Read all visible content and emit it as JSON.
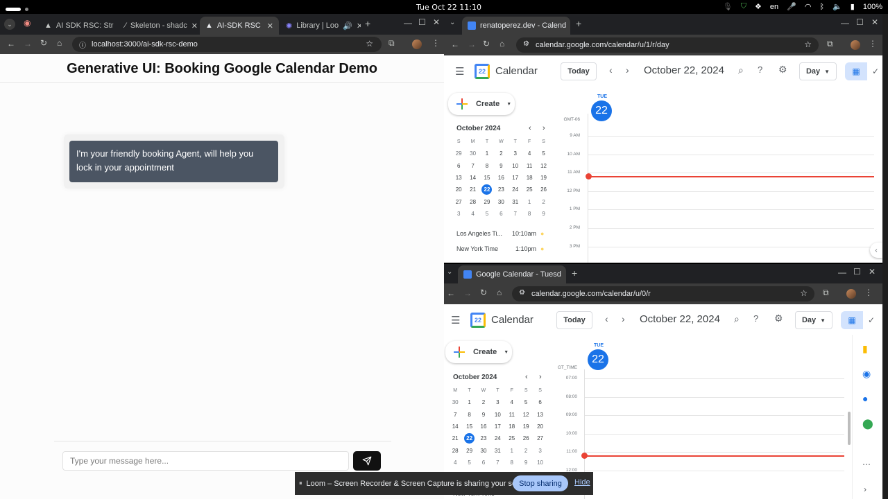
{
  "system": {
    "clock": "Tue Oct 22  11:10",
    "lang": "en",
    "battery": "100%"
  },
  "left_browser": {
    "tabs": [
      {
        "label": "AI SDK RSC: Str",
        "color": "#1a1a1a"
      },
      {
        "label": "Skeleton - shadc",
        "color": "#1a1a1a"
      },
      {
        "label": "AI-SDK RSC",
        "color": "#1a1a1a",
        "active": true
      },
      {
        "label": "Library | Loo",
        "color": "#625df5"
      }
    ],
    "url": "localhost:3000/ai-sdk-rsc-demo"
  },
  "app": {
    "title": "Generative UI: Booking Google Calendar Demo",
    "agent_message": "I'm your friendly booking Agent, will help you lock in your appointment",
    "input_placeholder": "Type your message here..."
  },
  "cal_top": {
    "tab_label": "renatoperez.dev - Calend",
    "url": "calendar.google.com/calendar/u/1/r/day",
    "app_name": "Calendar",
    "today_btn": "Today",
    "date_title": "October 22, 2024",
    "view": "Day",
    "create": "Create",
    "mini_month": "October 2024",
    "dow": [
      "S",
      "M",
      "T",
      "W",
      "T",
      "F",
      "S"
    ],
    "weeks": [
      [
        "29",
        "30",
        "1",
        "2",
        "3",
        "4",
        "5"
      ],
      [
        "6",
        "7",
        "8",
        "9",
        "10",
        "11",
        "12"
      ],
      [
        "13",
        "14",
        "15",
        "16",
        "17",
        "18",
        "19"
      ],
      [
        "20",
        "21",
        "22",
        "23",
        "24",
        "25",
        "26"
      ],
      [
        "27",
        "28",
        "29",
        "30",
        "31",
        "1",
        "2"
      ],
      [
        "3",
        "4",
        "5",
        "6",
        "7",
        "8",
        "9"
      ]
    ],
    "day_dow": "TUE",
    "day_num": "22",
    "tz": "GMT-06",
    "hours": [
      "9 AM",
      "10 AM",
      "11 AM",
      "12 PM",
      "1 PM",
      "2 PM",
      "3 PM"
    ],
    "clocks": [
      {
        "label": "Los Angeles Ti...",
        "time": "10:10am"
      },
      {
        "label": "New York Time",
        "time": "1:10pm"
      }
    ]
  },
  "cal_bottom": {
    "tab_label": "Google Calendar - Tuesd",
    "url": "calendar.google.com/calendar/u/0/r",
    "app_name": "Calendar",
    "today_btn": "Today",
    "date_title": "October 22, 2024",
    "view": "Day",
    "create": "Create",
    "mini_month": "October 2024",
    "dow": [
      "M",
      "T",
      "W",
      "T",
      "F",
      "S",
      "S"
    ],
    "weeks": [
      [
        "30",
        "1",
        "2",
        "3",
        "4",
        "5",
        "6"
      ],
      [
        "7",
        "8",
        "9",
        "10",
        "11",
        "12",
        "13"
      ],
      [
        "14",
        "15",
        "16",
        "17",
        "18",
        "19",
        "20"
      ],
      [
        "21",
        "22",
        "23",
        "24",
        "25",
        "26",
        "27"
      ],
      [
        "28",
        "29",
        "30",
        "31",
        "1",
        "2",
        "3"
      ],
      [
        "4",
        "5",
        "6",
        "7",
        "8",
        "9",
        "10"
      ]
    ],
    "day_dow": "TUE",
    "day_num": "22",
    "tz": "GT_TIME",
    "hours": [
      "07:00",
      "08:00",
      "09:00",
      "10:00",
      "11:00",
      "12:00"
    ],
    "clock_partial": "New York Time"
  },
  "loom": {
    "message": "Loom – Screen Recorder & Screen Capture is sharing your screen.",
    "stop": "Stop sharing",
    "hide": "Hide"
  }
}
